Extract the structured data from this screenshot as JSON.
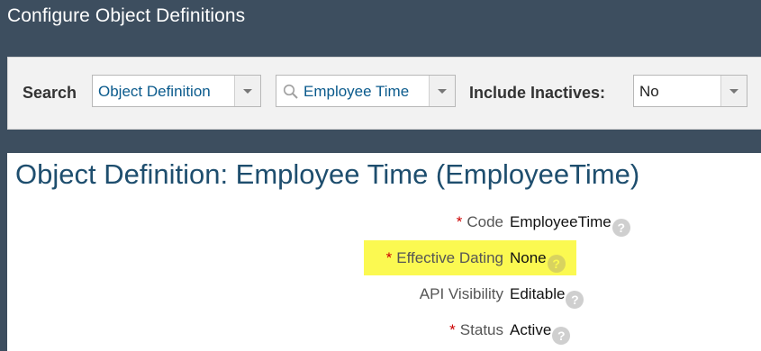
{
  "page": {
    "title": "Configure Object Definitions"
  },
  "search": {
    "label": "Search",
    "type_value": "Object Definition",
    "query_value": "Employee Time",
    "inactives_label": "Include Inactives:",
    "inactives_value": "No"
  },
  "detail": {
    "title": "Object Definition: Employee Time (EmployeeTime)",
    "fields": [
      {
        "label": "Code",
        "required": "*",
        "value": "EmployeeTime",
        "help": "?"
      },
      {
        "label": "Effective Dating",
        "required": "*",
        "value": "None",
        "help": "?",
        "highlighted": true
      },
      {
        "label": "API Visibility",
        "required": "",
        "value": "Editable",
        "help": "?"
      },
      {
        "label": "Status",
        "required": "*",
        "value": "Active",
        "help": "?"
      }
    ]
  },
  "colors": {
    "background": "#3d4e5f",
    "title_blue": "#1e4e6e",
    "required_red": "#cc0000",
    "highlight_yellow": "#fbf951"
  }
}
